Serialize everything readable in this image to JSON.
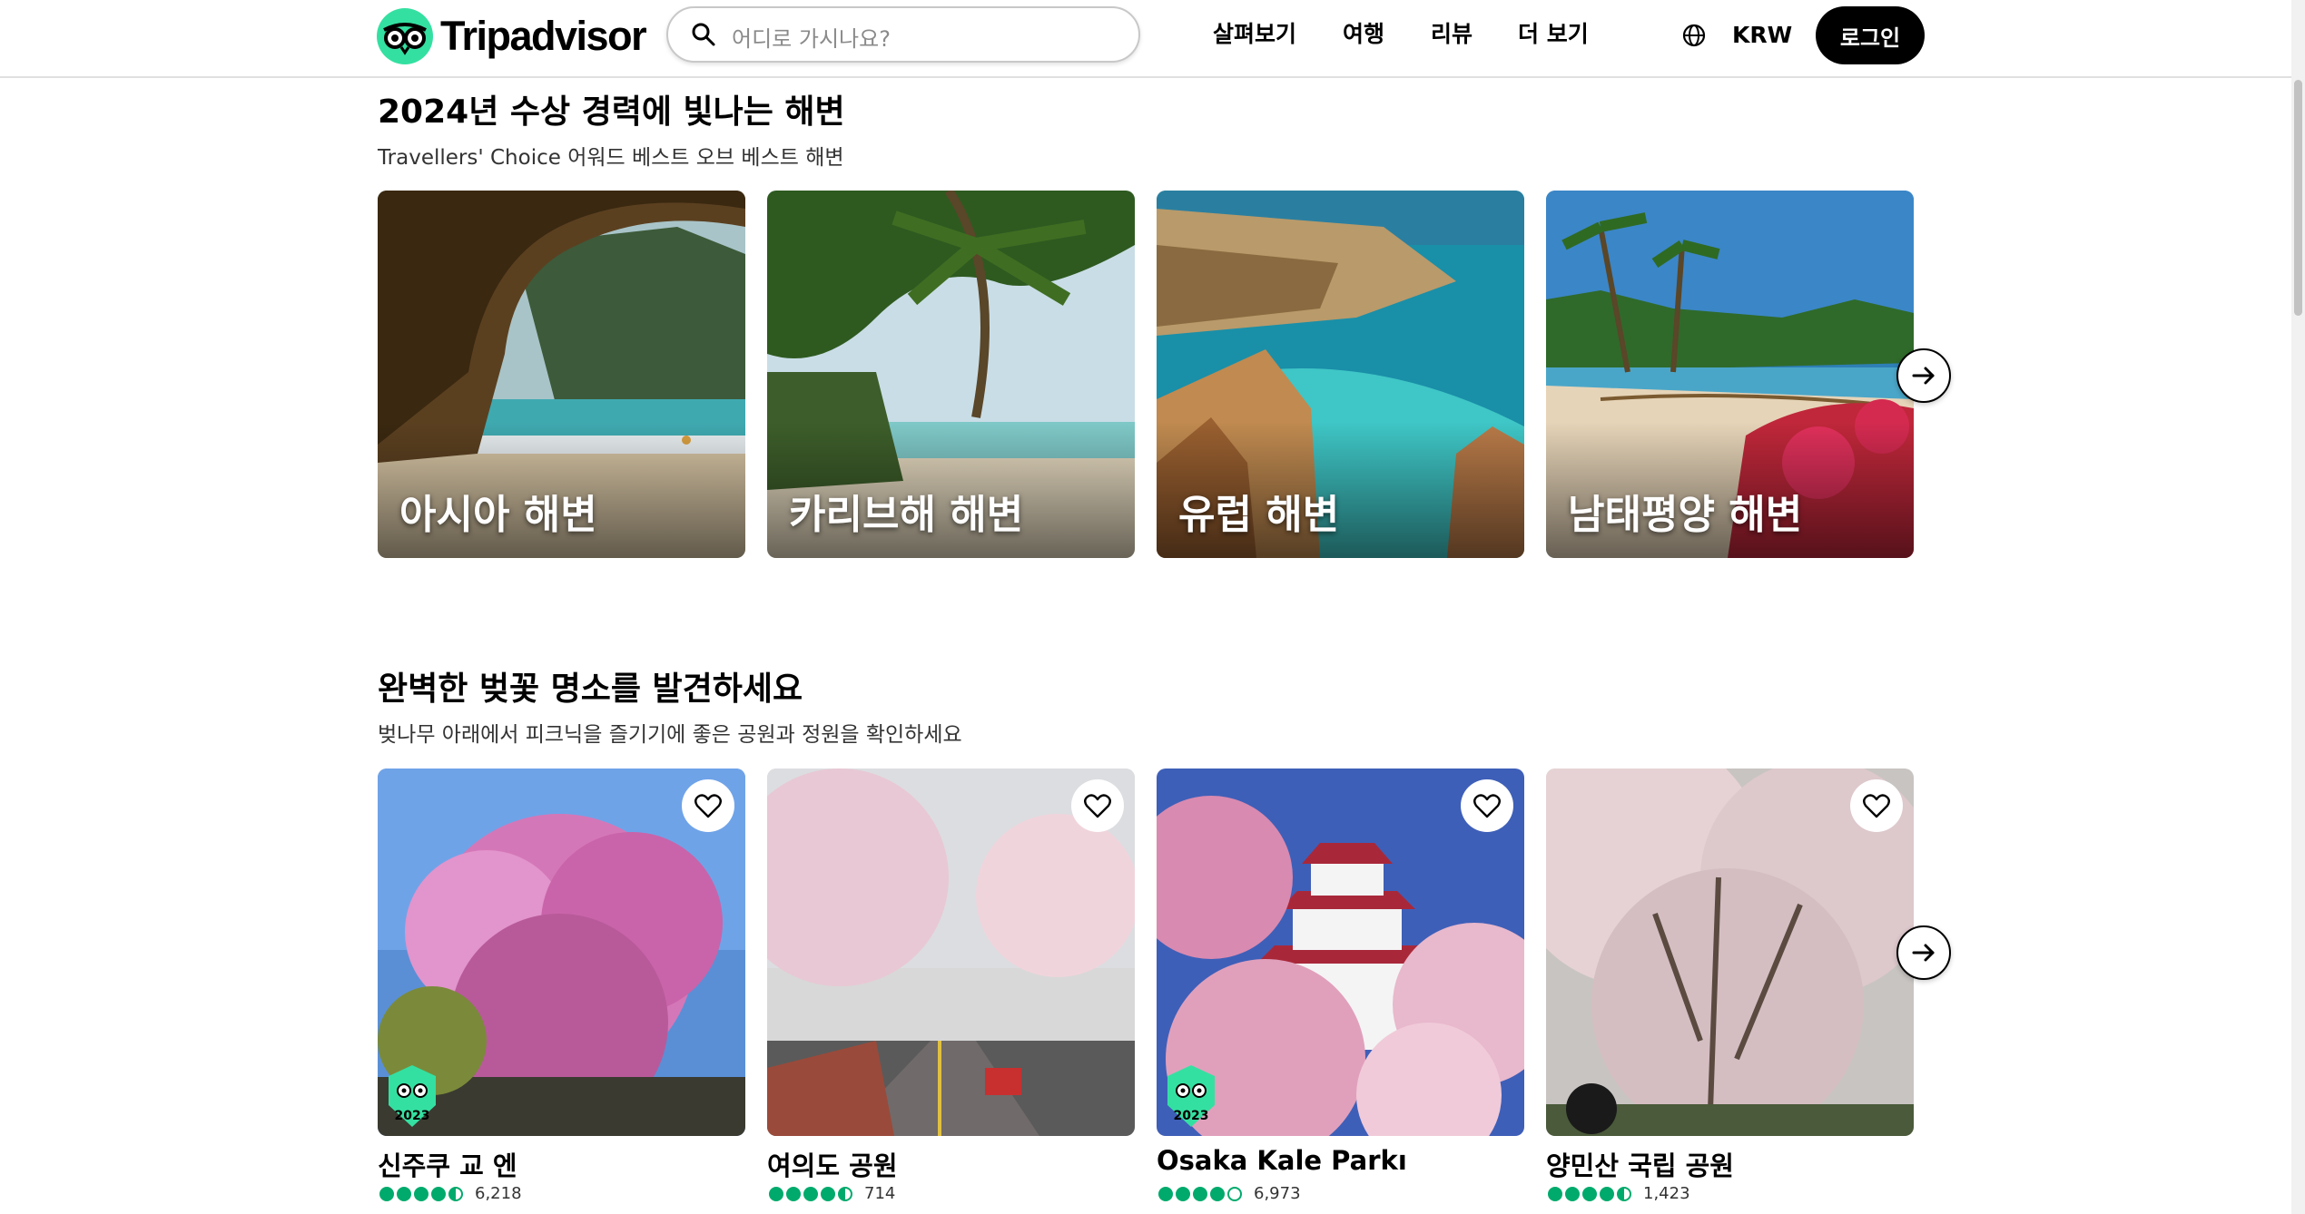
{
  "header": {
    "brand": "Tripadvisor",
    "search_placeholder": "어디로 가시나요?",
    "nav": [
      "살펴보기",
      "여행",
      "리뷰",
      "더 보기"
    ],
    "currency": "KRW",
    "login": "로그인"
  },
  "beaches": {
    "title": "2024년 수상 경력에 빛나는 해변",
    "subtitle": "Travellers' Choice 어워드 베스트 오브 베스트 해변",
    "cards": [
      {
        "label": "아시아 해변"
      },
      {
        "label": "카리브해 해변"
      },
      {
        "label": "유럽 해변"
      },
      {
        "label": "남태평양 해변"
      }
    ]
  },
  "blossoms": {
    "title": "완벽한 벚꽃 명소를 발견하세요",
    "subtitle": "벚나무 아래에서 피크닉을 즐기기에 좋은 공원과 정원을 확인하세요",
    "cards": [
      {
        "name": "신주쿠 교 엔",
        "rating": 4.5,
        "reviews": "6,218",
        "award": "2023"
      },
      {
        "name": "여의도 공원",
        "rating": 4.5,
        "reviews": "714",
        "award": ""
      },
      {
        "name": "Osaka Kale Parkı",
        "rating": 4.0,
        "reviews": "6,973",
        "award": "2023"
      },
      {
        "name": "양민산 국립 공원",
        "rating": 4.5,
        "reviews": "1,423",
        "award": ""
      }
    ]
  },
  "colors": {
    "brand_green": "#34e0a1",
    "rating_green": "#00aa6c",
    "login_bg": "#000000"
  }
}
